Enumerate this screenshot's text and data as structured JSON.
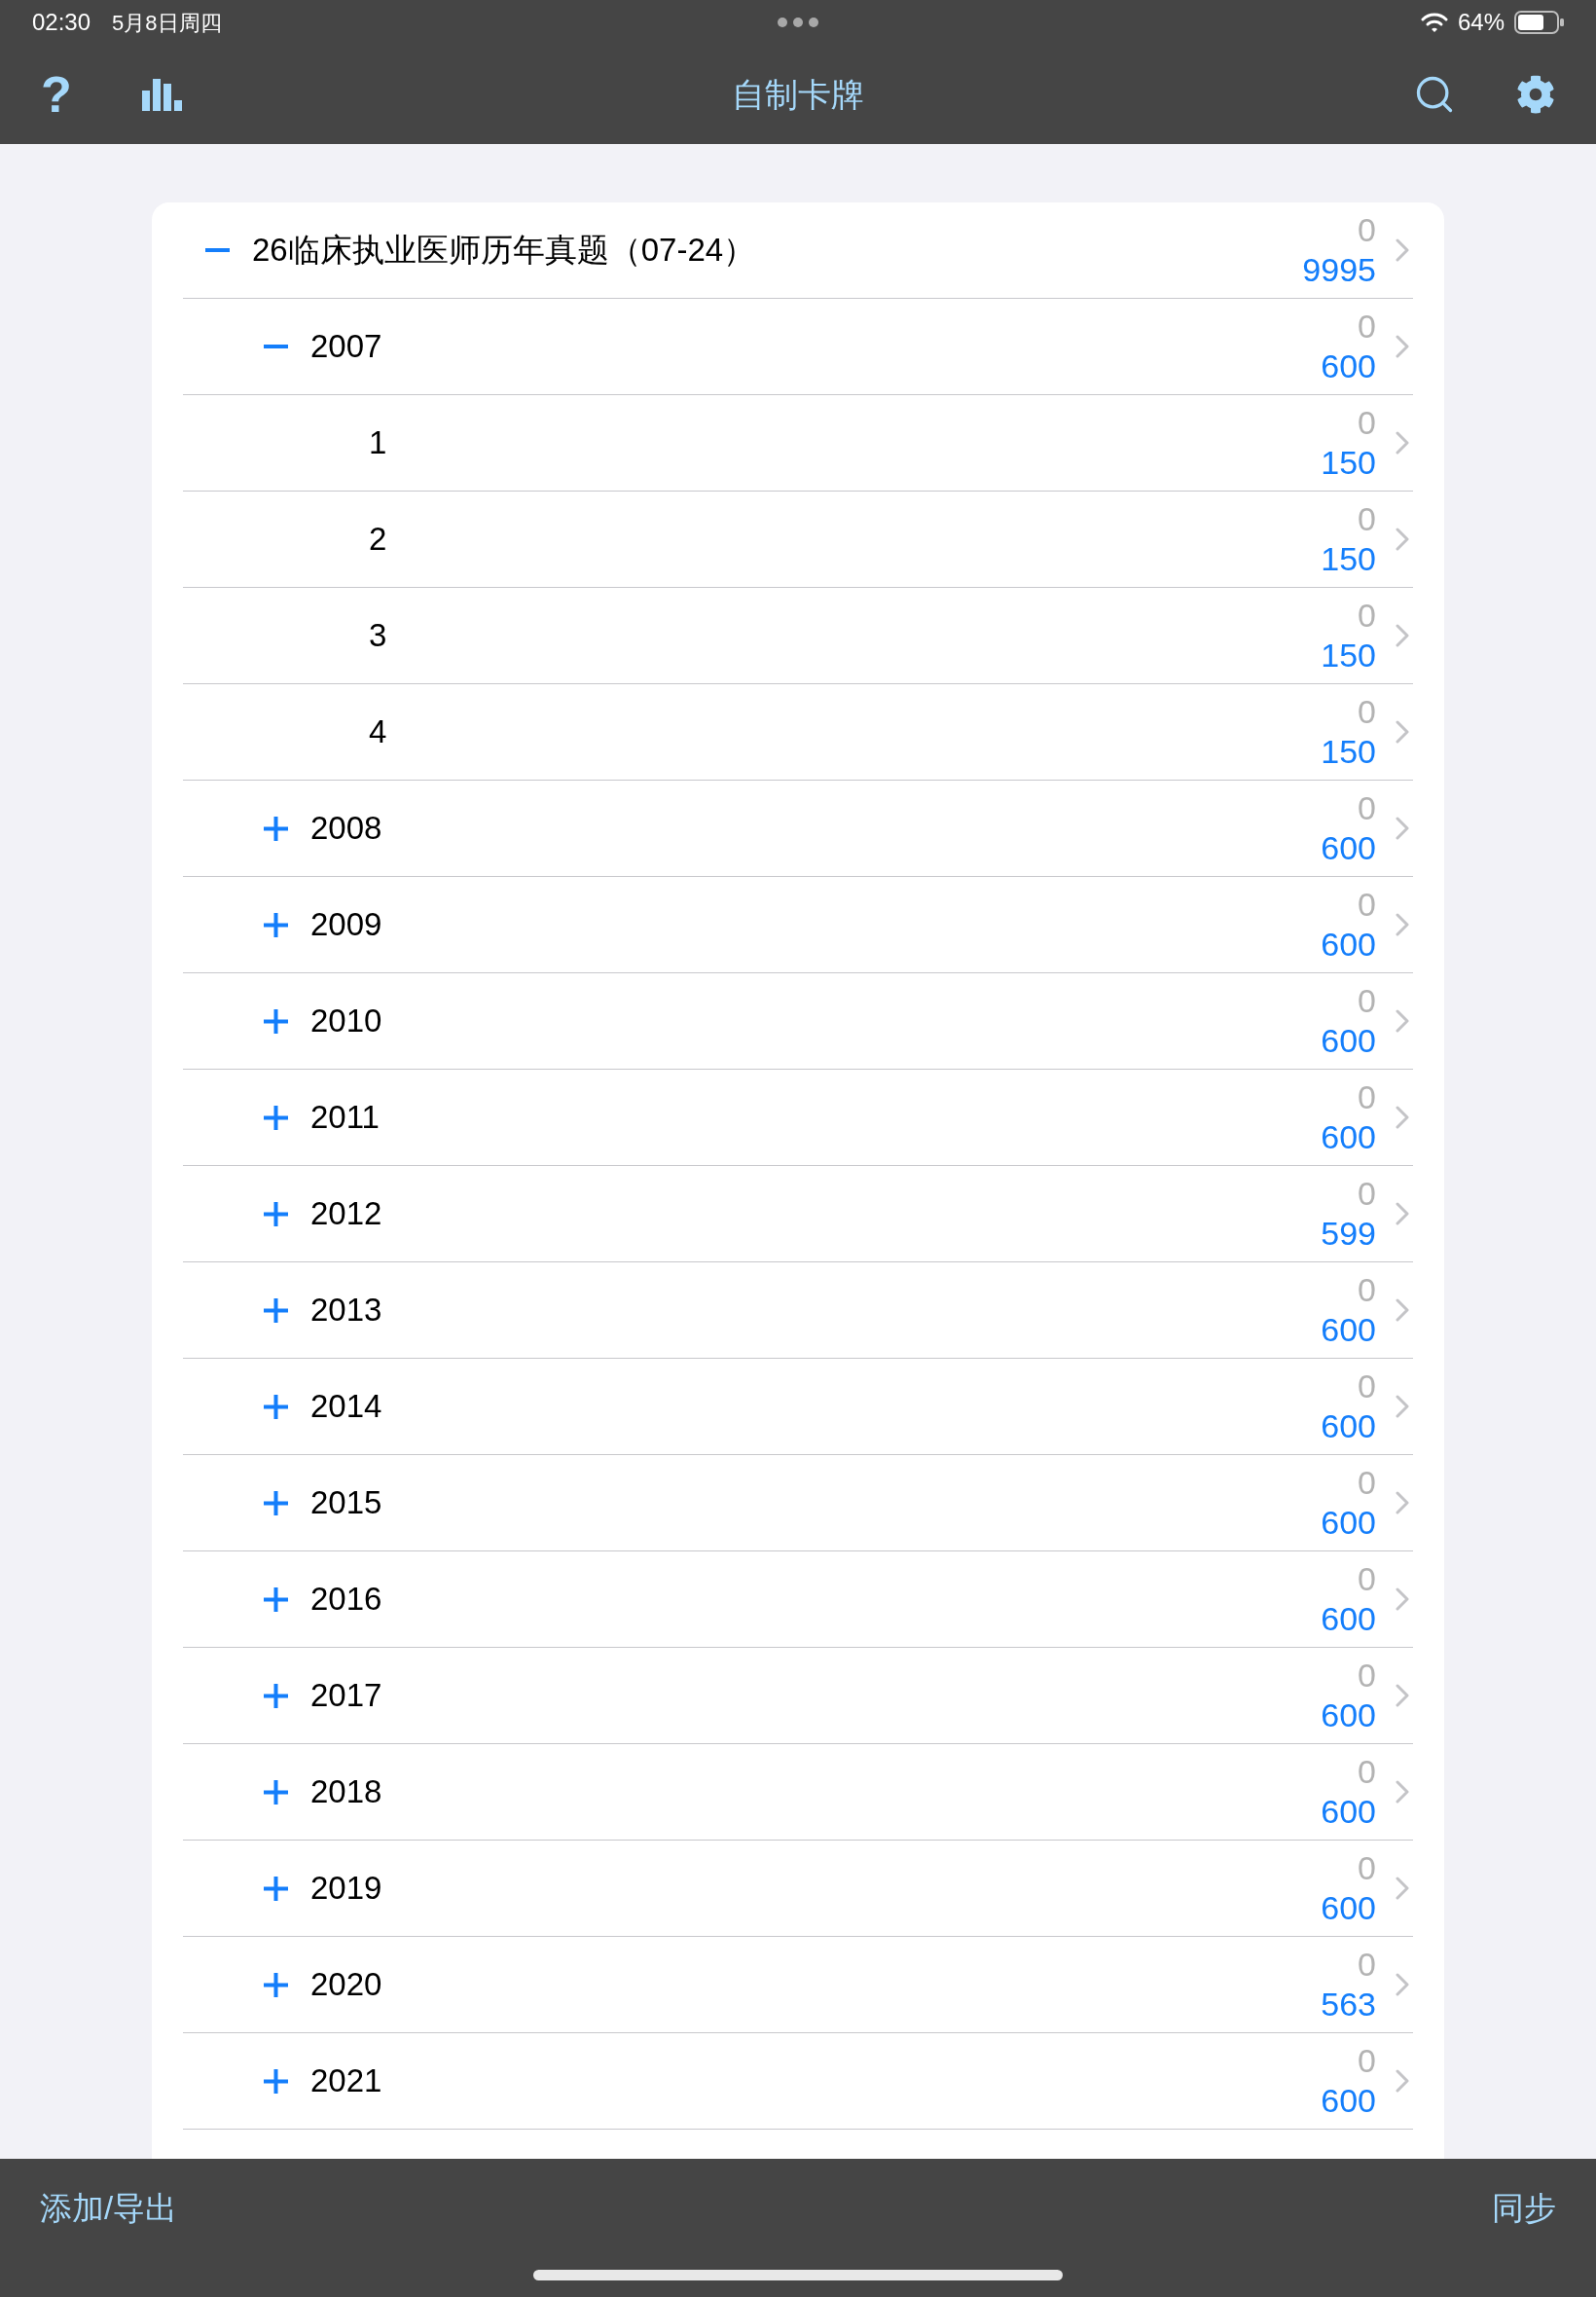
{
  "status_bar": {
    "time": "02:30",
    "date": "5月8日周四",
    "battery": "64%"
  },
  "toolbar": {
    "help": "?",
    "title": "自制卡牌"
  },
  "decks": [
    {
      "name": "26临床执业医师历年真题（07-24）",
      "expanded": true,
      "due": "0",
      "total": "9995",
      "children": [
        {
          "name": "2007",
          "expanded": true,
          "due": "0",
          "total": "600",
          "children": [
            {
              "name": "1",
              "due": "0",
              "total": "150"
            },
            {
              "name": "2",
              "due": "0",
              "total": "150"
            },
            {
              "name": "3",
              "due": "0",
              "total": "150"
            },
            {
              "name": "4",
              "due": "0",
              "total": "150"
            }
          ]
        },
        {
          "name": "2008",
          "expanded": false,
          "due": "0",
          "total": "600"
        },
        {
          "name": "2009",
          "expanded": false,
          "due": "0",
          "total": "600"
        },
        {
          "name": "2010",
          "expanded": false,
          "due": "0",
          "total": "600"
        },
        {
          "name": "2011",
          "expanded": false,
          "due": "0",
          "total": "600"
        },
        {
          "name": "2012",
          "expanded": false,
          "due": "0",
          "total": "599"
        },
        {
          "name": "2013",
          "expanded": false,
          "due": "0",
          "total": "600"
        },
        {
          "name": "2014",
          "expanded": false,
          "due": "0",
          "total": "600"
        },
        {
          "name": "2015",
          "expanded": false,
          "due": "0",
          "total": "600"
        },
        {
          "name": "2016",
          "expanded": false,
          "due": "0",
          "total": "600"
        },
        {
          "name": "2017",
          "expanded": false,
          "due": "0",
          "total": "600"
        },
        {
          "name": "2018",
          "expanded": false,
          "due": "0",
          "total": "600"
        },
        {
          "name": "2019",
          "expanded": false,
          "due": "0",
          "total": "600"
        },
        {
          "name": "2020",
          "expanded": false,
          "due": "0",
          "total": "563"
        },
        {
          "name": "2021",
          "expanded": false,
          "due": "0",
          "total": "600"
        }
      ]
    }
  ],
  "bottom_bar": {
    "left": "添加/导出",
    "right": "同步"
  }
}
